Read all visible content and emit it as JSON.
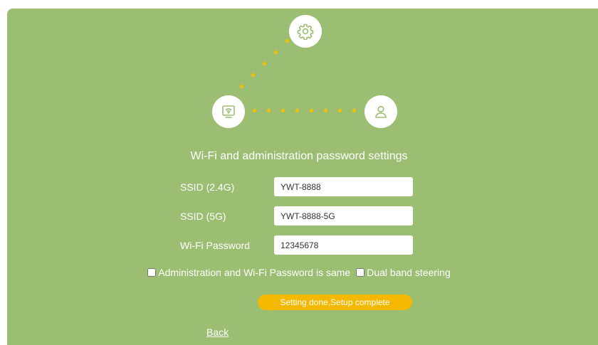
{
  "title": "Wi-Fi and administration password settings",
  "icons": {
    "top": "gear-icon",
    "left": "router-wifi-icon",
    "right": "user-icon"
  },
  "colors": {
    "panel": "#9cbe72",
    "accent": "#f5b800",
    "dots": "#f2c200"
  },
  "form": {
    "ssid24": {
      "label": "SSID (2.4G)",
      "value": "YWT-8888"
    },
    "ssid5": {
      "label": "SSID (5G)",
      "value": "YWT-8888-5G"
    },
    "password": {
      "label": "Wi-Fi Password",
      "value": "12345678"
    }
  },
  "options": {
    "same_password": {
      "label": "Administration and Wi-Fi Password is same",
      "checked": false
    },
    "dual_band": {
      "label": "Dual band steering",
      "checked": false
    }
  },
  "actions": {
    "done_label": "Setting done,Setup complete",
    "back_label": "Back"
  }
}
